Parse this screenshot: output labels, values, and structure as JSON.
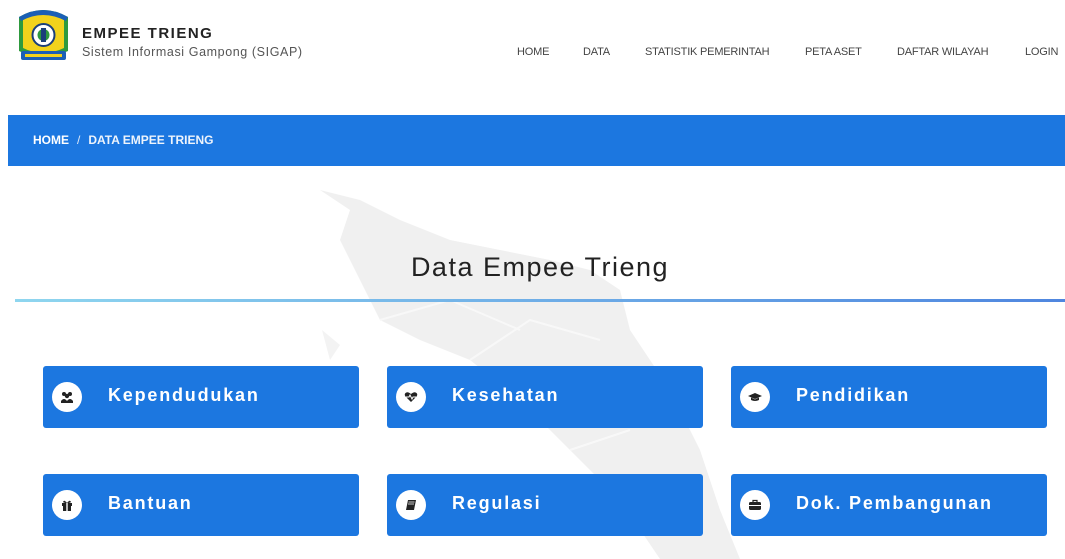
{
  "brand": {
    "title": "EMPEE TRIENG",
    "subtitle": "Sistem Informasi Gampong (SIGAP)",
    "logo_icon": "regency-emblem-icon"
  },
  "nav": {
    "items": [
      {
        "label": "HOME"
      },
      {
        "label": "DATA"
      },
      {
        "label": "STATISTIK PEMERINTAH"
      },
      {
        "label": "PETA ASET"
      },
      {
        "label": "DAFTAR WILAYAH"
      },
      {
        "label": "LOGIN"
      }
    ]
  },
  "breadcrumb": {
    "home": "HOME",
    "separator": "/",
    "current": "DATA EMPEE TRIENG"
  },
  "main": {
    "title": "Data Empee Trieng",
    "categories": [
      {
        "label": "Kependudukan",
        "icon": "users-icon"
      },
      {
        "label": "Kesehatan",
        "icon": "heartbeat-icon"
      },
      {
        "label": "Pendidikan",
        "icon": "graduation-cap-icon"
      },
      {
        "label": "Bantuan",
        "icon": "gift-icon"
      },
      {
        "label": "Regulasi",
        "icon": "book-icon"
      },
      {
        "label": "Dok. Pembangunan",
        "icon": "briefcase-icon"
      }
    ]
  },
  "colors": {
    "primary": "#1c77e0",
    "title_line_start": "#8fd6ef",
    "title_line_end": "#4f86df",
    "map_shade": "#f0f0f0"
  }
}
